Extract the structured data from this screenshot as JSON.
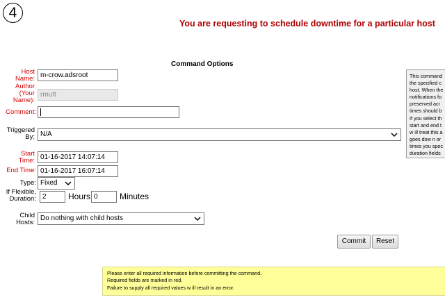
{
  "step_number": "4",
  "heading": "You are requesting to schedule downtime for a particular host",
  "section_title": "Command Options",
  "form": {
    "host_name": {
      "label_1": "Host",
      "label_2": "Name:",
      "value": "m-crow.adsroot"
    },
    "author": {
      "label_1": "Author",
      "label_2": "(Your",
      "label_3": "Name):",
      "value": "rmutt"
    },
    "comment": {
      "label": "Comment:",
      "value": ""
    },
    "triggered_by": {
      "label_1": "Triggered",
      "label_2": "By:",
      "selected": "N/A"
    },
    "start_time": {
      "label_1": "Start",
      "label_2": "Time:",
      "value": "01-16-2017 14:07:14"
    },
    "end_time": {
      "label": "End Time:",
      "value": "01-16-2017 16:07:14"
    },
    "type": {
      "label": "Type:",
      "selected": "Fixed"
    },
    "flexible_duration": {
      "label_1": "If Flexible,",
      "label_2": "Duration:",
      "hours_value": "2",
      "hours_label": "Hours",
      "minutes_value": "0",
      "minutes_label": "Minutes"
    },
    "child_hosts": {
      "label_1": "Child",
      "label_2": "Hosts:",
      "selected": "Do nothing with child hosts"
    }
  },
  "buttons": {
    "commit": "Commit",
    "reset": "Reset"
  },
  "side_help_lines": [
    "This command",
    "the specified c",
    "host. When the",
    "notifications fo",
    "preserved acr",
    "times should b",
    "If you select th",
    "start and end t",
    "w ill treat this a",
    "goes dow n or",
    "times you spec",
    "duration fields"
  ],
  "notice_lines": [
    "Please enter all required information before committing the command.",
    "Required fields are marked in red.",
    "Failure to supply all required values w ill result in an error."
  ],
  "colors": {
    "required_label": "#d40000",
    "heading": "#b00000",
    "notice_bg": "#ffff99"
  }
}
